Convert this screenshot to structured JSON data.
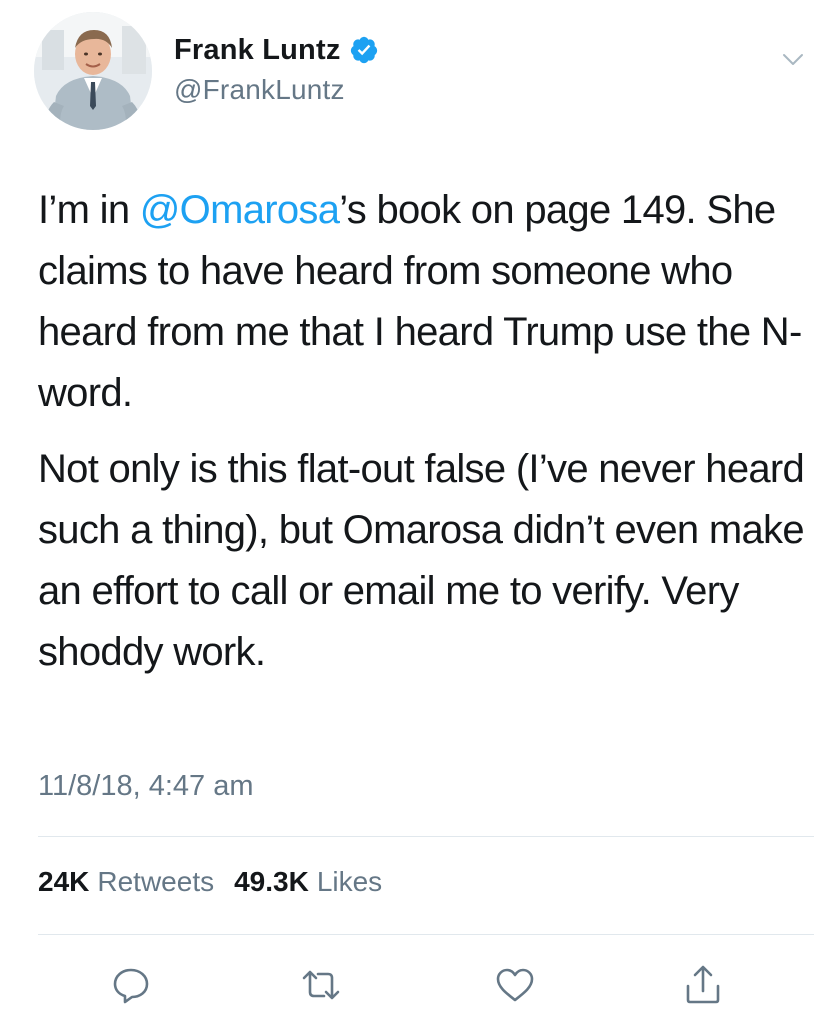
{
  "user": {
    "display_name": "Frank Luntz",
    "handle": "@FrankLuntz",
    "verified": true
  },
  "tweet": {
    "p1_before": "I’m in ",
    "p1_mention": "@Omarosa",
    "p1_after": "’s book on page 149. She claims to have heard from someone who heard from me that I heard Trump use the N-word.",
    "p2": "Not only is this flat-out false (I’ve never heard such a thing), but Omarosa didn’t even make an effort to call or email me to verify. Very shoddy work.",
    "timestamp": "11/8/18, 4:47 am"
  },
  "stats": {
    "retweets_count": "24K",
    "retweets_label": "Retweets",
    "likes_count": "49.3K",
    "likes_label": "Likes"
  },
  "icons": {
    "verified": "verified-badge-icon",
    "caret": "chevron-down-icon",
    "reply": "reply-icon",
    "retweet": "retweet-icon",
    "like": "heart-icon",
    "share": "share-icon"
  },
  "colors": {
    "accent": "#1da1f2",
    "text": "#14171a",
    "secondary": "#657786",
    "divider": "#e1e8ed"
  }
}
